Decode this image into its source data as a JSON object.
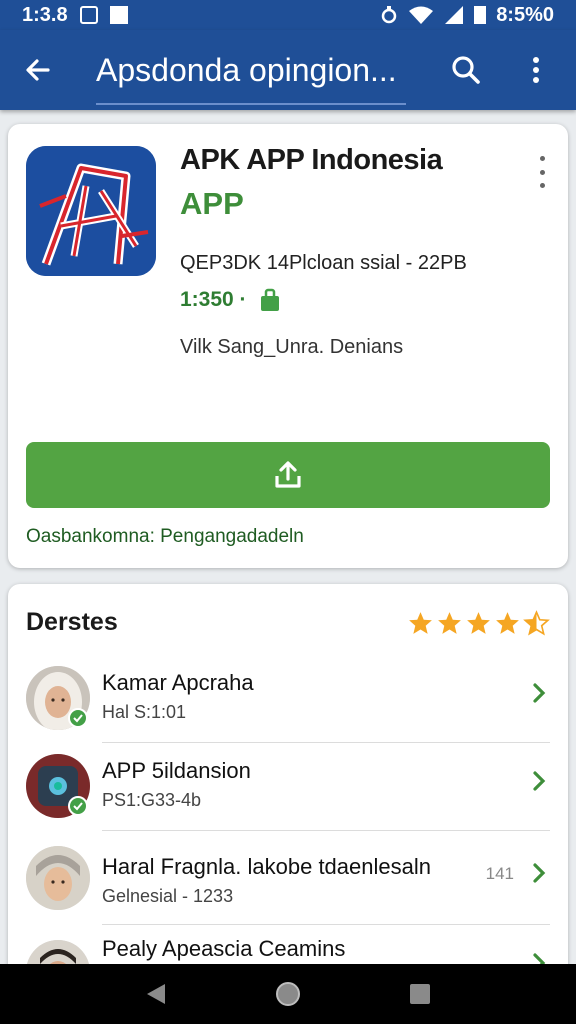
{
  "status_bar": {
    "time": "1:3.8",
    "battery": "8:5%0"
  },
  "app_bar": {
    "title": "Apsdonda opingion..."
  },
  "app_card": {
    "title": "APK APP Indonesia",
    "subtitle": "APP",
    "meta": "QEP3DK 14Plcloan ssial - 22PB",
    "price": "1:350 ·",
    "developer": "Vilk Sang_Unra. Denians",
    "install_note": "Oasbankomna: Pengangadadeln"
  },
  "list_card": {
    "title": "Derstes",
    "rating_stars": 4.5,
    "items": [
      {
        "name": "Kamar Apcraha",
        "sub": "Hal S:1:01",
        "count": ""
      },
      {
        "name": "APP 5ildansion",
        "sub": "PS1:G33-4b",
        "count": ""
      },
      {
        "name": "Haral Fragnla. lakobe tdaenlesaln",
        "sub": "Gelnesial - 1233",
        "count": "141"
      },
      {
        "name": "Pealy Apeascia Ceamins",
        "sub": "",
        "count": ""
      }
    ]
  },
  "colors": {
    "primary": "#1f4f97",
    "accent_green": "#53a443",
    "star": "#f5a623"
  },
  "icons": [
    "back-arrow-icon",
    "search-icon",
    "kebab-menu-icon",
    "install-upload-icon",
    "store-bag-icon",
    "star-icon",
    "chevron-right-icon",
    "verified-check-icon",
    "nav-back-icon",
    "nav-home-icon",
    "nav-recents-icon"
  ]
}
